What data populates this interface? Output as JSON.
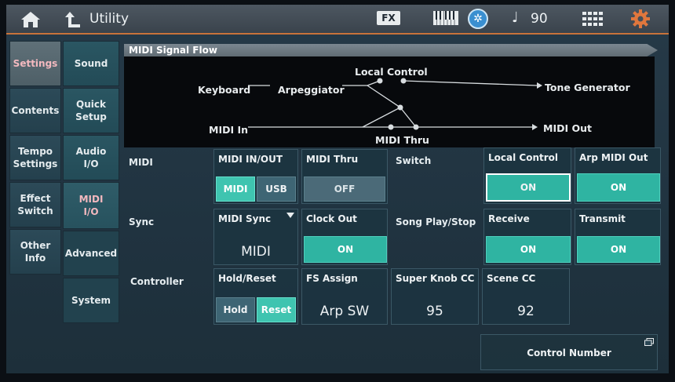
{
  "header": {
    "title": "Utility",
    "fx_label": "FX",
    "tempo_note": "♩",
    "tempo": "90"
  },
  "main_tabs": [
    {
      "label": "Settings",
      "selected": true
    },
    {
      "label": "Contents",
      "selected": false
    },
    {
      "label": "Tempo\nSettings",
      "selected": false
    },
    {
      "label": "Effect\nSwitch",
      "selected": false
    },
    {
      "label": "Other\nInfo",
      "selected": false
    }
  ],
  "sub_tabs": [
    {
      "label": "Sound",
      "selected": false
    },
    {
      "label": "Quick\nSetup",
      "selected": false
    },
    {
      "label": "Audio\nI/O",
      "selected": false
    },
    {
      "label": "MIDI\nI/O",
      "selected": true
    },
    {
      "label": "Advanced",
      "selected": false
    },
    {
      "label": "System",
      "selected": false
    }
  ],
  "signal_flow": {
    "header": "MIDI Signal Flow",
    "local_control": "Local Control",
    "keyboard": "Keyboard",
    "arpeggiator": "Arpeggiator",
    "tone_generator": "Tone Generator",
    "midi_in": "MIDI In",
    "midi_thru": "MIDI Thru",
    "midi_out": "MIDI Out"
  },
  "rows": {
    "midi": {
      "category": "MIDI",
      "midi_in_out": {
        "label": "MIDI IN/OUT",
        "options": [
          "MIDI",
          "USB"
        ],
        "selected": "MIDI"
      },
      "midi_thru": {
        "label": "MIDI Thru",
        "value": "OFF"
      },
      "switch_label": "Switch",
      "local_control": {
        "label": "Local Control",
        "value": "ON"
      },
      "arp_midi_out": {
        "label": "Arp MIDI Out",
        "value": "ON"
      }
    },
    "sync": {
      "category": "Sync",
      "midi_sync": {
        "label": "MIDI Sync",
        "value": "MIDI"
      },
      "clock_out": {
        "label": "Clock Out",
        "value": "ON"
      },
      "song_play_stop": "Song Play/Stop",
      "receive": {
        "label": "Receive",
        "value": "ON"
      },
      "transmit": {
        "label": "Transmit",
        "value": "ON"
      }
    },
    "controller": {
      "category": "Controller",
      "hold_reset": {
        "label": "Hold/Reset",
        "options": [
          "Hold",
          "Reset"
        ],
        "selected": "Reset"
      },
      "fs_assign": {
        "label": "FS Assign",
        "value": "Arp SW"
      },
      "super_knob_cc": {
        "label": "Super Knob CC",
        "value": "95"
      },
      "scene_cc": {
        "label": "Scene CC",
        "value": "92"
      }
    }
  },
  "control_number": "Control Number",
  "colors": {
    "accent_orange": "#c8733b",
    "on_teal": "#3fc4b0",
    "selected_tab_text": "#f3b9bf"
  }
}
